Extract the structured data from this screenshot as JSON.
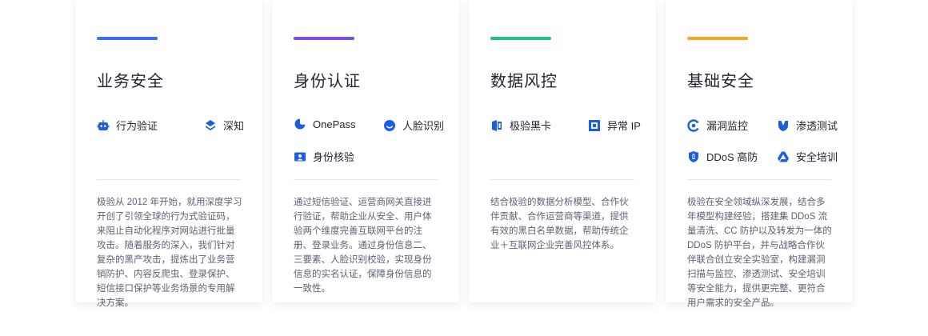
{
  "colors": {
    "business_accent": "#3c6cf0",
    "identity_accent": "#7b4be6",
    "data_accent": "#23c285",
    "basic_accent": "#f5a623",
    "icon_blue": "#1a5fe0"
  },
  "cards": [
    {
      "title": "业务安全",
      "products": [
        {
          "label": "行为验证",
          "icon": "robot-icon"
        },
        {
          "label": "深知",
          "icon": "layers-icon"
        }
      ],
      "description": "极验从 2012 年开始，就用深度学习开创了引领全球的行为式验证码，来阻止自动化程序对网站进行批量攻击。随着服务的深入，我们针对复杂的黑产攻击，提炼出了业务营销防护、内容反爬虫、登录保护、短信接口保护等业务场景的专用解决方案。"
    },
    {
      "title": "身份认证",
      "products": [
        {
          "label": "OnePass",
          "icon": "onepass-icon"
        },
        {
          "label": "人脸识别",
          "icon": "smile-face-icon"
        },
        {
          "label": "身份核验",
          "icon": "id-card-icon"
        }
      ],
      "description": "通过短信验证、运营商网关直接进行验证，帮助企业从安全、用户体验两个维度完善互联网平台的注册、登录业务。通过身份信息二、三要素、人脸识别校验，实现身份信息的实名认证，保障身份信息的一致性。"
    },
    {
      "title": "数据风控",
      "products": [
        {
          "label": "极验黑卡",
          "icon": "black-card-icon"
        },
        {
          "label": "异常 IP",
          "icon": "abnormal-ip-icon"
        }
      ],
      "description": "结合极验的数据分析模型、合作伙伴贡献、合作运营商等渠道，提供有效的黑白名单数据，帮助传统企业＋互联网企业完善风控体系。"
    },
    {
      "title": "基础安全",
      "products": [
        {
          "label": "漏洞监控",
          "icon": "monitor-icon"
        },
        {
          "label": "渗透测试",
          "icon": "shield-icon"
        },
        {
          "label": "DDoS 高防",
          "icon": "ddos-shield-icon"
        },
        {
          "label": "安全培训",
          "icon": "triangle-drive-icon"
        }
      ],
      "description": "极验在安全领域纵深发展，结合多年模型构建经验，搭建集 DDoS 流量清洗、CC 防护以及转发为一体的 DDoS 防护平台，并与战略合作伙伴联合创立安全实验室，构建漏洞扫描与监控、渗透测试、安全培训等安全能力，提供更完整、更符合用户需求的安全产品。"
    }
  ]
}
